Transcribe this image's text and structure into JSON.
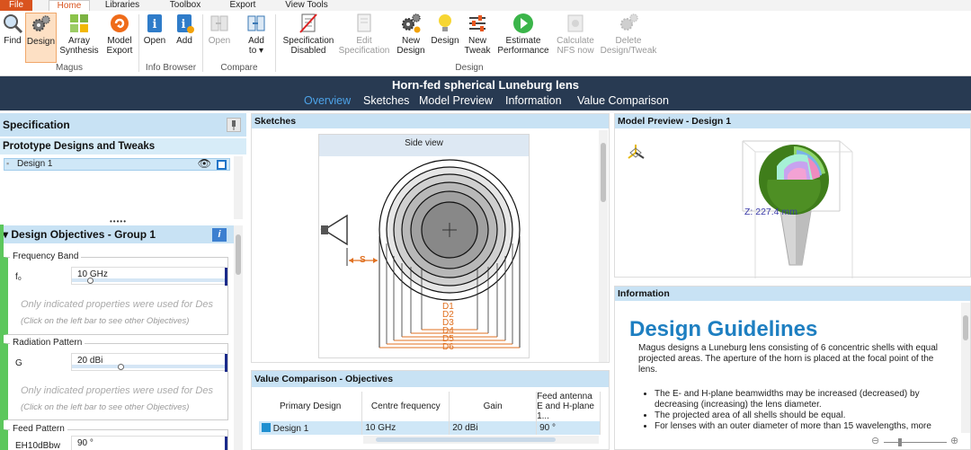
{
  "ribbon_tabs": [
    "File",
    "Home",
    "Libraries",
    "Toolbox",
    "Export",
    "View Tools"
  ],
  "ribbon": {
    "find": "Find",
    "design": "Design",
    "array_synthesis": [
      "Array",
      "Synthesis"
    ],
    "model_export": [
      "Model",
      "Export"
    ],
    "open": "Open",
    "add": "Add",
    "compare_open": "Open",
    "add_to": [
      "Add",
      "to ▾"
    ],
    "spec_disabled": [
      "Specification",
      "Disabled"
    ],
    "edit_spec": [
      "Edit",
      "Specification"
    ],
    "new_design": [
      "New",
      "Design"
    ],
    "design2": "Design",
    "new_tweak": [
      "New",
      "Tweak"
    ],
    "estimate_performance": [
      "Estimate",
      "Performance"
    ],
    "calculate_nfs": [
      "Calculate",
      "NFS now"
    ],
    "delete_design": [
      "Delete",
      "Design/Tweak"
    ],
    "groups": {
      "magus": "Magus",
      "info_browser": "Info Browser",
      "compare": "Compare",
      "design": "Design"
    }
  },
  "app_title": "Horn-fed spherical Luneburg lens",
  "nav_tabs": [
    "Overview",
    "Sketches",
    "Model Preview",
    "Information",
    "Value Comparison"
  ],
  "specification": {
    "title": "Specification",
    "prototypes_title": "Prototype Designs and Tweaks",
    "designs": [
      "Design 1"
    ],
    "dots": "•••••"
  },
  "objectives": {
    "title": "Design Objectives  -  Group 1",
    "frequency_band": {
      "legend": "Frequency Band",
      "label": "f₀",
      "value": "10 GHz",
      "position": 0.1
    },
    "radiation_pattern": {
      "legend": "Radiation Pattern",
      "label": "G",
      "value": "20 dBi",
      "position": 0.3
    },
    "feed_pattern": {
      "legend": "Feed Pattern",
      "label": "EH10dBbw",
      "value": "90 °"
    },
    "note_main": "Only indicated properties were used for Des",
    "note_sub": "(Click on the left bar to see other Objectives)"
  },
  "sketches": {
    "title": "Sketches",
    "view_title": "Side view",
    "s_label": "S",
    "d_labels": [
      "D1",
      "D2",
      "D3",
      "D4",
      "D5",
      "D6"
    ]
  },
  "value_comparison": {
    "title": "Value Comparison - Objectives",
    "headers": [
      "Primary Design",
      "Centre frequency",
      "Gain",
      "Feed antenna E and H-plane 1..."
    ],
    "rows": [
      [
        "Design 1",
        "10 GHz",
        "20 dBi",
        "90 °"
      ]
    ]
  },
  "model_preview": {
    "title": "Model Preview  -  Design 1",
    "z_label": "Z: 227.4 mm"
  },
  "information": {
    "title": "Information",
    "heading": "Design Guidelines",
    "intro": "Magus designs a Luneburg lens consisting of 6 concentric shells with equal projected areas. The aperture of the horn is placed at the focal point of the lens.",
    "bullets": [
      "The E- and H-plane beamwidths may be increased (decreased) by decreasing (increasing) the lens diameter.",
      "The projected area of all shells should be equal.",
      "For lenses with an outer diameter of more than 15 wavelengths, more"
    ]
  }
}
